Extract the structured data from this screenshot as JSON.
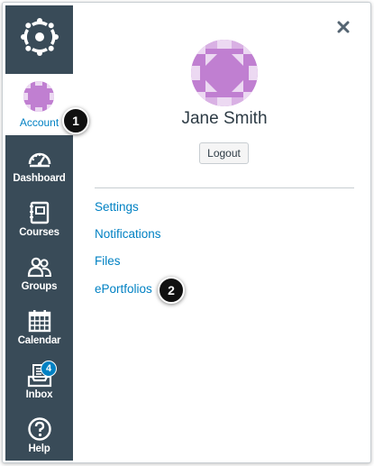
{
  "nav": {
    "logo_icon": "canvas-logo-icon",
    "account": {
      "label": "Account"
    },
    "items": [
      {
        "label": "Dashboard",
        "icon": "dashboard-icon"
      },
      {
        "label": "Courses",
        "icon": "courses-icon"
      },
      {
        "label": "Groups",
        "icon": "groups-icon"
      },
      {
        "label": "Calendar",
        "icon": "calendar-icon"
      },
      {
        "label": "Inbox",
        "icon": "inbox-icon",
        "badge": "4"
      },
      {
        "label": "Help",
        "icon": "help-icon"
      }
    ]
  },
  "tray": {
    "close_icon": "close-icon",
    "user_name": "Jane Smith",
    "logout_label": "Logout",
    "links": [
      "Settings",
      "Notifications",
      "Files",
      "ePortfolios"
    ]
  },
  "callouts": [
    "1",
    "2"
  ],
  "colors": {
    "nav_bg": "#394b58",
    "link": "#0081c3",
    "avatar": "#c07fd1",
    "badge": "#0081c3"
  }
}
